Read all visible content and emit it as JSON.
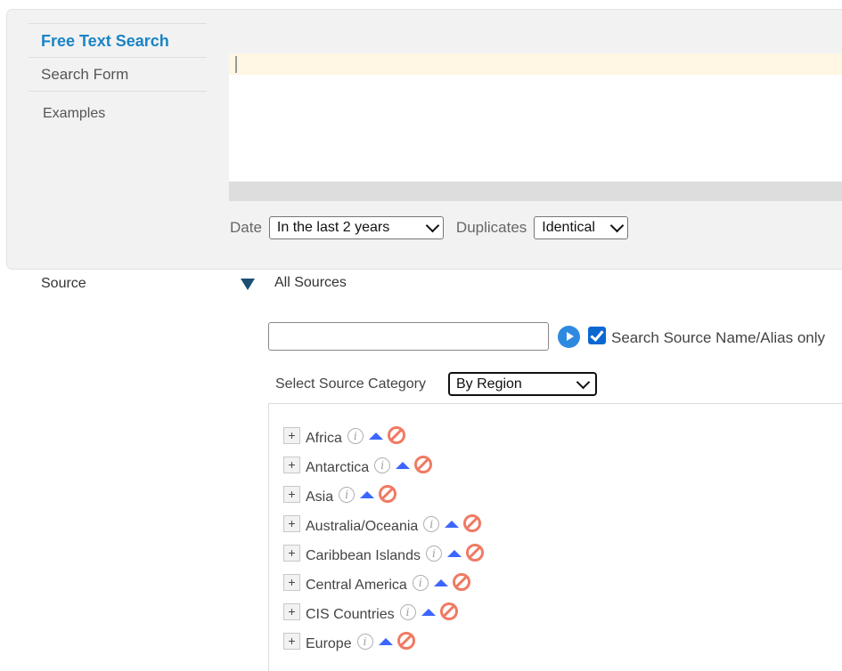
{
  "nav": {
    "title": "Free Text Search",
    "items": [
      "Search Form",
      "Examples"
    ]
  },
  "filters": {
    "date_label": "Date",
    "date_value": "In the last 2 years",
    "duplicates_label": "Duplicates",
    "duplicates_value": "Identical"
  },
  "source": {
    "label": "Source",
    "all_sources": "All Sources",
    "search_value": "",
    "search_checkbox_label": "Search Source Name/Alias only",
    "category_label": "Select Source Category",
    "category_value": "By Region",
    "regions": [
      "Africa",
      "Antarctica",
      "Asia",
      "Australia/Oceania",
      "Caribbean Islands",
      "Central America",
      "CIS Countries",
      "Europe"
    ]
  },
  "icons": {
    "expand": "plus-icon",
    "info": "info-icon",
    "include": "triangle-up-icon",
    "exclude": "ban-icon"
  },
  "colors": {
    "accent": "#1a84c6",
    "include": "#3b66ff",
    "exclude": "#f07a63"
  }
}
